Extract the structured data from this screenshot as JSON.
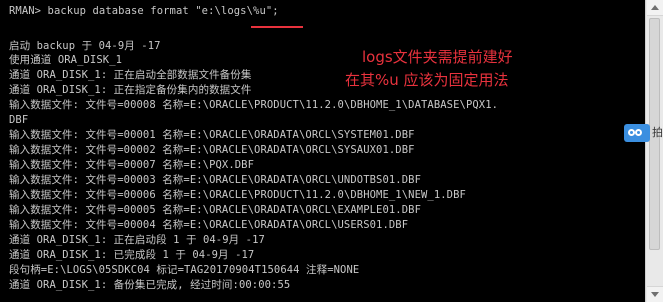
{
  "console": {
    "lines": [
      "RMAN> backup database format \"e:\\logs\\%u\";",
      "",
      "",
      "启动 backup 于 04-9月 -17",
      "使用通道 ORA_DISK_1",
      "通道 ORA_DISK_1: 正在启动全部数据文件备份集",
      "通道 ORA_DISK_1: 正在指定备份集内的数据文件",
      "输入数据文件: 文件号=00008 名称=E:\\ORACLE\\PRODUCT\\11.2.0\\DBHOME_1\\DATABASE\\PQX1.",
      "DBF",
      "输入数据文件: 文件号=00001 名称=E:\\ORACLE\\ORADATA\\ORCL\\SYSTEM01.DBF",
      "输入数据文件: 文件号=00002 名称=E:\\ORACLE\\ORADATA\\ORCL\\SYSAUX01.DBF",
      "输入数据文件: 文件号=00007 名称=E:\\PQX.DBF",
      "输入数据文件: 文件号=00003 名称=E:\\ORACLE\\ORADATA\\ORCL\\UNDOTBS01.DBF",
      "输入数据文件: 文件号=00006 名称=E:\\ORACLE\\PRODUCT\\11.2.0\\DBHOME_1\\NEW_1.DBF",
      "输入数据文件: 文件号=00005 名称=E:\\ORACLE\\ORADATA\\ORCL\\EXAMPLE01.DBF",
      "输入数据文件: 文件号=00004 名称=E:\\ORACLE\\ORADATA\\ORCL\\USERS01.DBF",
      "通道 ORA_DISK_1: 正在启动段 1 于 04-9月 -17",
      "通道 ORA_DISK_1: 已完成段 1 于 04-9月 -17",
      "段句柄=E:\\LOGS\\05SDKC04 标记=TAG20170904T150644 注释=NONE",
      "通道 ORA_DISK_1: 备份集已完成, 经过时间:00:00:55"
    ]
  },
  "annotations": {
    "line1": "logs文件夹需提前建好",
    "line2": "在其%u 应该为固定用法"
  },
  "side_widget": {
    "icon": "cloud-icon",
    "label": "拍"
  },
  "colors": {
    "background": "#000000",
    "text": "#c8c8c8",
    "annotation": "#e8323d",
    "widget_blue": "#3b8fe0"
  }
}
